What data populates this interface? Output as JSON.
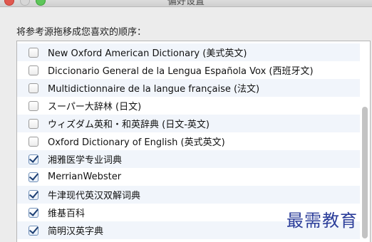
{
  "window": {
    "title": "偏好设置"
  },
  "instruction": "将参考源拖移成您喜欢的顺序：",
  "dictionaries": [
    {
      "label": "New Oxford American Dictionary (美式英文)",
      "checked": false
    },
    {
      "label": "Diccionario General de la Lengua Española Vox (西班牙文)",
      "checked": false
    },
    {
      "label": "Multidictionnaire de la langue française (法文)",
      "checked": false
    },
    {
      "label": "スーパー大辞林 (日文)",
      "checked": false
    },
    {
      "label": "ウィズダム英和・和英辞典 (日文-英文)",
      "checked": false
    },
    {
      "label": "Oxford Dictionary of English (英式英文)",
      "checked": false
    },
    {
      "label": "湘雅医学专业词典",
      "checked": true
    },
    {
      "label": "MerrianWebster",
      "checked": true
    },
    {
      "label": "牛津现代英汉双解词典",
      "checked": true
    },
    {
      "label": "维基百科",
      "checked": true
    },
    {
      "label": "简明汉英字典",
      "checked": true
    }
  ],
  "watermark": "最需教育"
}
